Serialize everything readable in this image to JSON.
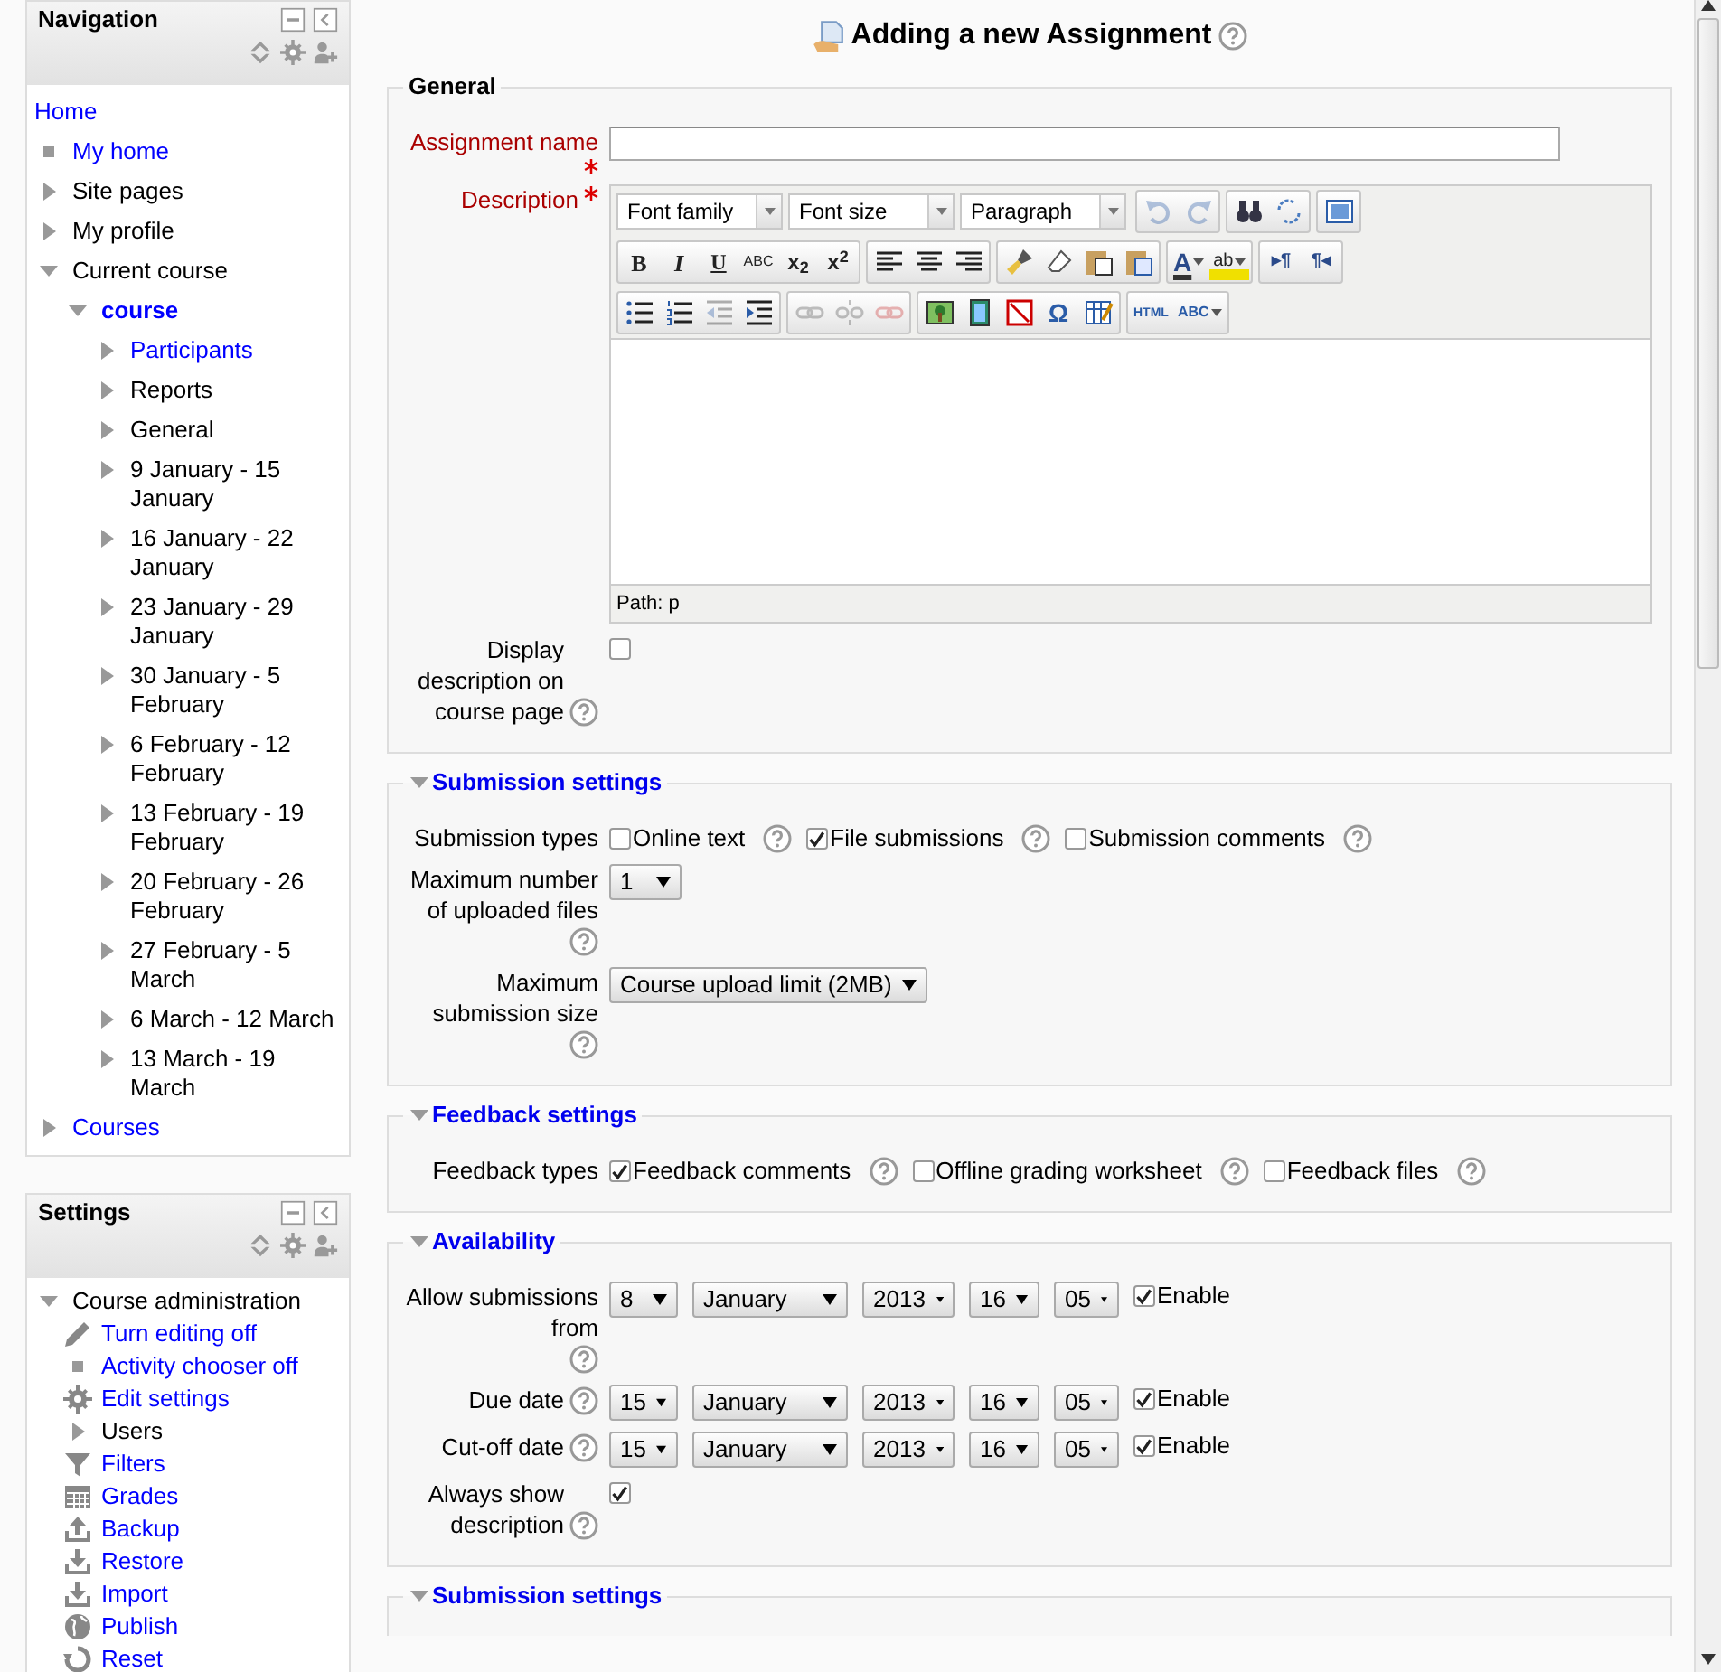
{
  "navigation": {
    "title": "Navigation",
    "items": [
      {
        "label": "Home",
        "kind": "root",
        "link": true,
        "current": false
      },
      {
        "label": "My home",
        "kind": "leaf",
        "link": true,
        "current": false
      },
      {
        "label": "Site pages",
        "kind": "branch",
        "expanded": false,
        "link": false,
        "current": false
      },
      {
        "label": "My profile",
        "kind": "branch",
        "expanded": false,
        "link": false,
        "current": false
      },
      {
        "label": "Current course",
        "kind": "branch",
        "expanded": true,
        "link": false,
        "current": false,
        "children": [
          {
            "label": "course",
            "kind": "branch",
            "expanded": true,
            "link": true,
            "current": true,
            "children": [
              {
                "label": "Participants",
                "kind": "branch",
                "expanded": false,
                "link": true,
                "current": false
              },
              {
                "label": "Reports",
                "kind": "branch",
                "expanded": false,
                "link": false,
                "current": false
              },
              {
                "label": "General",
                "kind": "branch",
                "expanded": false,
                "link": false,
                "current": false
              },
              {
                "label": "9 January - 15 January",
                "kind": "branch",
                "expanded": false,
                "link": false,
                "current": false
              },
              {
                "label": "16 January - 22 January",
                "kind": "branch",
                "expanded": false,
                "link": false,
                "current": false
              },
              {
                "label": "23 January - 29 January",
                "kind": "branch",
                "expanded": false,
                "link": false,
                "current": false
              },
              {
                "label": "30 January - 5 February",
                "kind": "branch",
                "expanded": false,
                "link": false,
                "current": false
              },
              {
                "label": "6 February - 12 February",
                "kind": "branch",
                "expanded": false,
                "link": false,
                "current": false
              },
              {
                "label": "13 February - 19 February",
                "kind": "branch",
                "expanded": false,
                "link": false,
                "current": false
              },
              {
                "label": "20 February - 26 February",
                "kind": "branch",
                "expanded": false,
                "link": false,
                "current": false
              },
              {
                "label": "27 February - 5 March",
                "kind": "branch",
                "expanded": false,
                "link": false,
                "current": false
              },
              {
                "label": "6 March - 12 March",
                "kind": "branch",
                "expanded": false,
                "link": false,
                "current": false
              },
              {
                "label": "13 March - 19 March",
                "kind": "branch",
                "expanded": false,
                "link": false,
                "current": false
              }
            ]
          }
        ]
      },
      {
        "label": "Courses",
        "kind": "branch",
        "expanded": false,
        "link": true,
        "current": false
      }
    ]
  },
  "settings": {
    "title": "Settings",
    "items": [
      {
        "label": "Course administration",
        "kind": "branch",
        "expanded": true,
        "link": false,
        "children": [
          {
            "label": "Turn editing off",
            "kind": "edit",
            "link": true
          },
          {
            "label": "Activity chooser off",
            "kind": "leaf",
            "link": true
          },
          {
            "label": "Edit settings",
            "kind": "settings",
            "link": true
          },
          {
            "label": "Users",
            "kind": "branch",
            "expanded": false,
            "link": false
          },
          {
            "label": "Filters",
            "kind": "filter",
            "link": true
          },
          {
            "label": "Grades",
            "kind": "grades",
            "link": true
          },
          {
            "label": "Backup",
            "kind": "backup",
            "link": true
          },
          {
            "label": "Restore",
            "kind": "restore",
            "link": true
          },
          {
            "label": "Import",
            "kind": "import",
            "link": true
          },
          {
            "label": "Publish",
            "kind": "publish",
            "link": true
          },
          {
            "label": "Reset",
            "kind": "reset",
            "link": true
          }
        ]
      }
    ]
  },
  "page": {
    "title": "Adding a new Assignment",
    "help": true
  },
  "sections": [
    {
      "legend": "General",
      "collapsible": false,
      "fields": [
        {
          "kind": "text",
          "label": "Assignment name",
          "required": true,
          "help": false
        },
        {
          "kind": "editor",
          "label": "Description",
          "required": true,
          "help": false,
          "path": "Path: p",
          "toolbar": [
            [
              [
                {
                  "kind": "dropdown",
                  "label": "Font family"
                },
                {
                  "kind": "dropdown",
                  "label": "Font size"
                },
                {
                  "kind": "dropdown",
                  "label": "Paragraph"
                }
              ],
              [
                {
                  "kind": "undo",
                  "disabled": true
                },
                {
                  "kind": "redo",
                  "disabled": true
                }
              ],
              [
                {
                  "kind": "find",
                  "disabled": false
                },
                {
                  "kind": "replace",
                  "disabled": false
                }
              ],
              [
                {
                  "kind": "fullscreen",
                  "disabled": false
                }
              ]
            ],
            [
              [
                {
                  "kind": "bold",
                  "glyph": "B",
                  "disabled": false
                },
                {
                  "kind": "italic",
                  "glyph": "I",
                  "disabled": false
                },
                {
                  "kind": "underline",
                  "glyph": "U",
                  "disabled": false
                },
                {
                  "kind": "strike",
                  "glyph": "ABC",
                  "disabled": false
                },
                {
                  "kind": "sub",
                  "glyph": "x$_{2}$",
                  "disabled": false
                },
                {
                  "kind": "sup",
                  "glyph": "x$^{2}$",
                  "disabled": false
                }
              ],
              [
                {
                  "kind": "align-left",
                  "disabled": false
                },
                {
                  "kind": "align-center",
                  "disabled": false
                },
                {
                  "kind": "align-right",
                  "disabled": false
                }
              ],
              [
                {
                  "kind": "cleanup",
                  "disabled": false
                },
                {
                  "kind": "eraser",
                  "disabled": false
                },
                {
                  "kind": "paste-text",
                  "disabled": false
                },
                {
                  "kind": "paste-word",
                  "disabled": false
                }
              ],
              [
                {
                  "kind": "textcolor",
                  "glyph": "A",
                  "disabled": false
                },
                {
                  "kind": "highlight",
                  "glyph": "ab",
                  "disabled": false
                }
              ],
              [
                {
                  "kind": "ltr",
                  "glyph": "▸¶",
                  "disabled": false
                },
                {
                  "kind": "rtl",
                  "glyph": "¶◂",
                  "disabled": false
                }
              ]
            ],
            [
              [
                {
                  "kind": "bullets",
                  "disabled": false
                },
                {
                  "kind": "numbers",
                  "disabled": false
                },
                {
                  "kind": "outdent",
                  "disabled": true
                },
                {
                  "kind": "indent",
                  "disabled": false
                }
              ],
              [
                {
                  "kind": "link",
                  "disabled": true
                },
                {
                  "kind": "unlink",
                  "disabled": true
                },
                {
                  "kind": "anchor",
                  "disabled": true
                }
              ],
              [
                {
                  "kind": "image",
                  "disabled": false
                },
                {
                  "kind": "media",
                  "disabled": false
                },
                {
                  "kind": "nonbreaking",
                  "disabled": false
                },
                {
                  "kind": "charmap",
                  "glyph": "Ω",
                  "disabled": false
                },
                {
                  "kind": "table",
                  "disabled": false
                }
              ],
              [
                {
                  "kind": "html",
                  "glyph": "HTML",
                  "disabled": false
                },
                {
                  "kind": "spellcheck",
                  "glyph": "ABC",
                  "disabled": false
                }
              ]
            ]
          ]
        },
        {
          "kind": "checkbox",
          "label": "Display description on course page",
          "required": false,
          "help": true,
          "checked": false
        }
      ]
    },
    {
      "legend": "Submission settings",
      "collapsible": true,
      "expanded": true,
      "fields": [
        {
          "kind": "checkgroup",
          "label": "Submission types",
          "required": false,
          "help": false,
          "options": [
            {
              "label": "Online text",
              "checked": false,
              "help": true
            },
            {
              "label": "File submissions",
              "checked": true,
              "help": true
            },
            {
              "label": "Submission comments",
              "checked": false,
              "help": true
            }
          ]
        },
        {
          "kind": "select",
          "label": "Maximum number of uploaded files",
          "required": false,
          "help": true,
          "value": "1"
        },
        {
          "kind": "select",
          "label": "Maximum submission size",
          "required": false,
          "help": true,
          "value": "Course upload limit (2MB)"
        }
      ]
    },
    {
      "legend": "Feedback settings",
      "collapsible": true,
      "expanded": true,
      "fields": [
        {
          "kind": "checkgroup",
          "label": "Feedback types",
          "required": false,
          "help": false,
          "options": [
            {
              "label": "Feedback comments",
              "checked": true,
              "help": true
            },
            {
              "label": "Offline grading worksheet",
              "checked": false,
              "help": true
            },
            {
              "label": "Feedback files",
              "checked": false,
              "help": true
            }
          ]
        }
      ]
    },
    {
      "legend": "Availability",
      "collapsible": true,
      "expanded": true,
      "fields": [
        {
          "kind": "date",
          "label": "Allow submissions from",
          "required": false,
          "help": true,
          "parts": [
            "8",
            "January",
            "2013",
            "16",
            "05"
          ],
          "enable_label": "Enable",
          "enabled": true
        },
        {
          "kind": "date",
          "label": "Due date",
          "required": false,
          "help": true,
          "parts": [
            "15",
            "January",
            "2013",
            "16",
            "05"
          ],
          "enable_label": "Enable",
          "enabled": true
        },
        {
          "kind": "date",
          "label": "Cut-off date",
          "required": false,
          "help": true,
          "parts": [
            "15",
            "January",
            "2013",
            "16",
            "05"
          ],
          "enable_label": "Enable",
          "enabled": true
        },
        {
          "kind": "checkbox",
          "label": "Always show description",
          "required": false,
          "help": true,
          "checked": true
        }
      ]
    },
    {
      "legend": "Submission settings",
      "collapsible": true,
      "expanded": true
    }
  ]
}
